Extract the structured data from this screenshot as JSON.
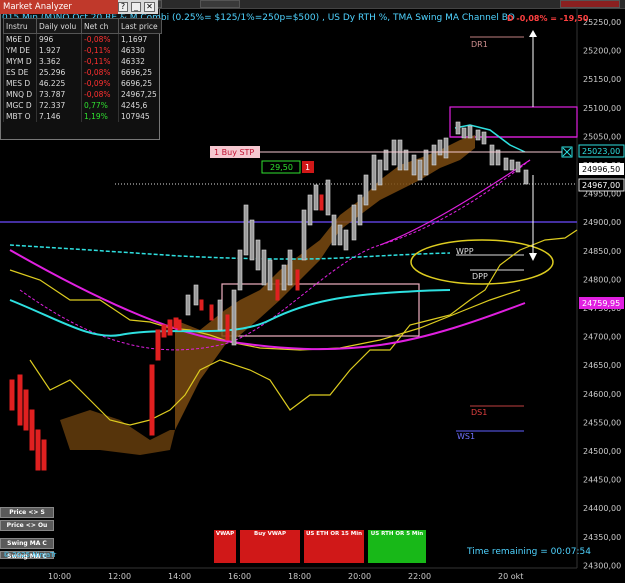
{
  "window": {
    "title": "015 Min (M)NQ Oct 20 RE & M Combi (0.25%= $125/1%=250p=$500) , US Dy RTH %, TMA Swing MA Channel BO"
  },
  "pnl_text": "D -0,08% = -19,50",
  "price_axis": {
    "ticks": [
      "25250,00",
      "25200,00",
      "25150,00",
      "25100,00",
      "25050,00",
      "25000,00",
      "24950,00",
      "24900,00",
      "24850,00",
      "24800,00",
      "24750,00",
      "24700,00",
      "24650,00",
      "24600,00",
      "24550,00",
      "24500,00",
      "24450,00",
      "24400,00",
      "24350,00",
      "24300,00"
    ],
    "labels": {
      "current_blue": "25023,00",
      "current_white": "24996,50",
      "dotted": "24967,00",
      "magenta": "24759,95"
    }
  },
  "time_axis": [
    "10:00",
    "12:00",
    "14:00",
    "16:00",
    "18:00",
    "20:00",
    "22:00",
    "20 okt"
  ],
  "levels": {
    "dr1": "DR1",
    "wpp": "WPP",
    "dpp": "DPP",
    "ds1": "DS1",
    "ws1": "WS1"
  },
  "order": {
    "label": "1 Buy STP",
    "price": "29,50",
    "qty": "1"
  },
  "market_analyzer": {
    "title": "Market Analyzer",
    "buttons": [
      "?",
      "_",
      "□",
      "✕"
    ],
    "headers": [
      "Instru",
      "Daily volu",
      "Net ch",
      "Last price"
    ],
    "rows": [
      [
        "M6E D",
        "996",
        "-0,08%",
        "1,1697"
      ],
      [
        "YM DE",
        "1.927",
        "-0,11%",
        "46330"
      ],
      [
        "MYM D",
        "3.362",
        "-0,11%",
        "46332"
      ],
      [
        "ES DE",
        "25.296",
        "-0,08%",
        "6696,25"
      ],
      [
        "MES D",
        "46.225",
        "-0,09%",
        "6696,25"
      ],
      [
        "MNQ D",
        "73.787",
        "-0,08%",
        "24967,25"
      ],
      [
        "MGC D",
        "72.337",
        "0,77%",
        "4245,6"
      ],
      [
        "MBT O",
        "7.146",
        "1,19%",
        "107945"
      ]
    ]
  },
  "side_buttons": [
    "Price <> S",
    "Price <> Ou",
    "Swing MA C",
    "Swing MA C"
  ],
  "bottom_buttons": [
    "VWAP",
    "Buy VWAP",
    "US ETH OR 15 Min",
    "US RTH OR 5 Min"
  ],
  "copyright": "© 2025 NinjaTr",
  "time_remaining": "Time remaining = 00:07:54",
  "colors": {
    "background": "#000000",
    "accent": "#4fd3ff",
    "negative": "#ff3030",
    "positive": "#2fe02f",
    "buy_button": "#d01818",
    "rth_button": "#18b818"
  }
}
